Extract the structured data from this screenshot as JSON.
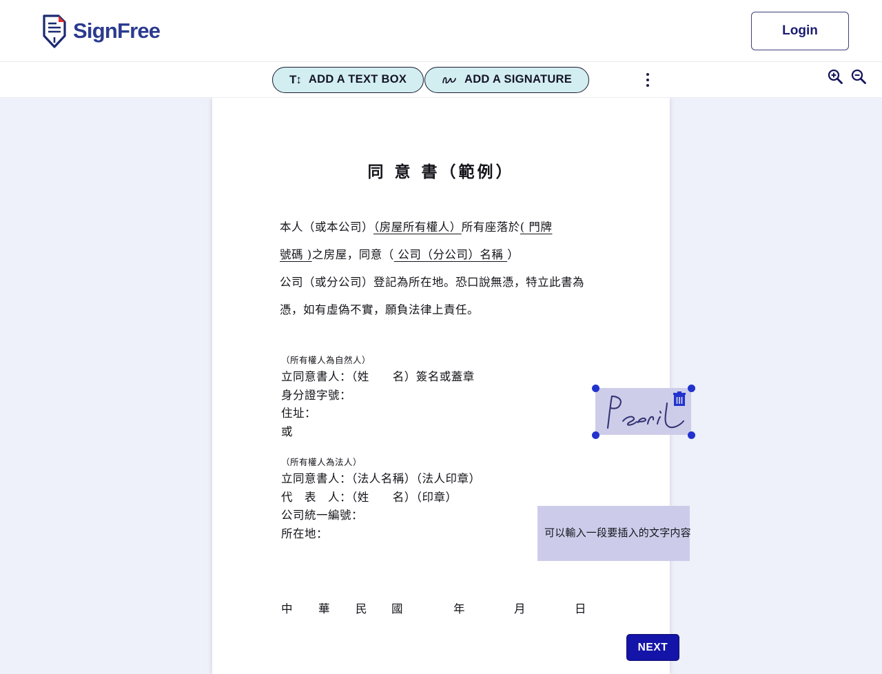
{
  "header": {
    "brand_name": "SignFree",
    "logo_icon": "document-pen-logo-icon",
    "login_label": "Login"
  },
  "toolbar": {
    "add_text_box_label": "ADD A TEXT BOX",
    "add_text_box_icon": "text-size-icon",
    "add_signature_label": "ADD A SIGNATURE",
    "add_signature_icon": "signature-scribble-icon",
    "more_options_icon": "kebab-menu-icon",
    "zoom_in_icon": "zoom-in-icon",
    "zoom_out_icon": "zoom-out-icon"
  },
  "document": {
    "title": "同 意 書（範例）",
    "paragraph_lines": [
      {
        "segments": [
          {
            "text": "本人（或本公司）",
            "underline": false
          },
          {
            "text": "（房屋所有權人）",
            "underline": true
          },
          {
            "text": "所有座落於",
            "underline": false
          },
          {
            "text": "(        門牌",
            "underline": true
          }
        ]
      },
      {
        "segments": [
          {
            "text": "號碼      )",
            "underline": true
          },
          {
            "text": "之房屋，同意（",
            "underline": false
          },
          {
            "text": "     公司（分公司）名稱     ",
            "underline": true
          },
          {
            "text": "）",
            "underline": false
          }
        ]
      },
      {
        "segments": [
          {
            "text": "公司（或分公司）登記為所在地。恐口說無憑，特立此書為",
            "underline": false
          }
        ]
      },
      {
        "segments": [
          {
            "text": "憑，如有虛偽不實，願負法律上責任。",
            "underline": false
          }
        ]
      }
    ],
    "natural_person": {
      "caption": "（所有權人為自然人）",
      "lines": [
        "立同意書人：（姓　　名）簽名或蓋章",
        "身分證字號：",
        "住址：",
        "或"
      ]
    },
    "legal_person": {
      "caption": "（所有權人為法人）",
      "lines": [
        "立同意書人：（法人名稱）（法人印章）",
        "代　表　人：（姓　　名）（印章）",
        "公司統一編號：",
        "所在地："
      ]
    },
    "date_line": [
      "中",
      "華",
      "民",
      "國",
      "年",
      "月",
      "日"
    ]
  },
  "overlays": {
    "signature": {
      "name": "signature-annotation",
      "ink_text": "PseriC",
      "delete_icon": "trash-icon",
      "fill_color": "#ccccea",
      "handle_color": "#1b2ccc"
    },
    "textbox": {
      "name": "text-annotation",
      "value": "可以輸入一段要插入的文字内容",
      "fill_color": "#ccccea"
    }
  },
  "footer": {
    "next_label": "NEXT"
  },
  "colors": {
    "brand_navy": "#2b3a8f",
    "accent_mint": "#d2eef1",
    "workspace_bg": "#eef0fa",
    "primary_button": "#1414a8"
  }
}
